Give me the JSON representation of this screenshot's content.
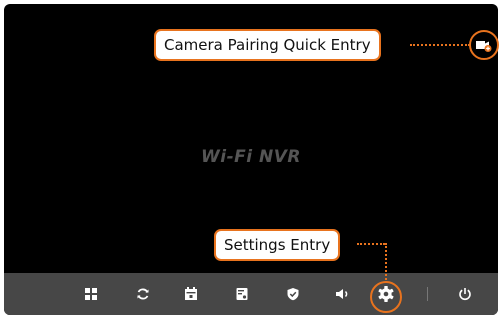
{
  "app": {
    "watermark": "Wi-Fi NVR"
  },
  "annotations": {
    "camera_pairing": "Camera Pairing Quick Entry",
    "settings": "Settings Entry"
  },
  "toolbar": {
    "items": [
      {
        "name": "grid-layout",
        "icon": "grid-icon"
      },
      {
        "name": "refresh",
        "icon": "refresh-icon"
      },
      {
        "name": "playback",
        "icon": "calendar-icon"
      },
      {
        "name": "storage",
        "icon": "disk-icon"
      },
      {
        "name": "security",
        "icon": "shield-icon"
      },
      {
        "name": "volume",
        "icon": "speaker-icon"
      },
      {
        "name": "settings",
        "icon": "gear-icon"
      },
      {
        "name": "power",
        "icon": "power-icon"
      }
    ]
  },
  "colors": {
    "background": "#000000",
    "toolbar": "#474747",
    "accent": "#e8731e",
    "icon": "#ffffff",
    "watermark": "#555555"
  }
}
